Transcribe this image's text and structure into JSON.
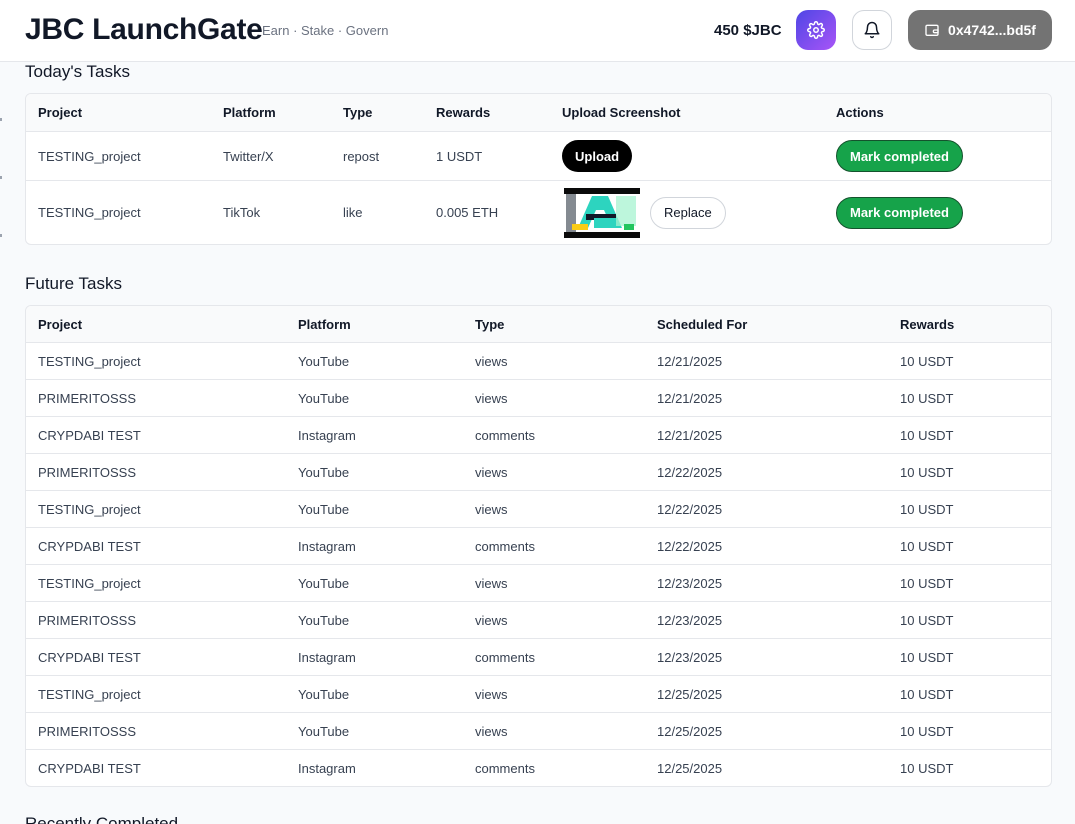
{
  "header": {
    "brand": "JBC LaunchGate",
    "tagline": "Earn · Stake · Govern",
    "balance": "450 $JBC",
    "wallet": "0x4742...bd5f",
    "icons": {
      "settings": "gear-icon",
      "notifications": "bell-icon",
      "wallet": "wallet-icon"
    },
    "accent_gradient": [
      "#4f46e5",
      "#a855f7"
    ]
  },
  "today": {
    "title": "Today's Tasks",
    "columns": [
      "Project",
      "Platform",
      "Type",
      "Rewards",
      "Upload Screenshot",
      "Actions"
    ],
    "rows": [
      {
        "project": "TESTING_project",
        "platform": "Twitter/X",
        "type": "repost",
        "rewards": "1 USDT",
        "upload_label": "Upload",
        "action": "Mark completed"
      },
      {
        "project": "TESTING_project",
        "platform": "TikTok",
        "type": "like",
        "rewards": "0.005 ETH",
        "replace_label": "Replace",
        "action": "Mark completed"
      }
    ]
  },
  "future": {
    "title": "Future Tasks",
    "columns": [
      "Project",
      "Platform",
      "Type",
      "Scheduled For",
      "Rewards"
    ],
    "rows": [
      {
        "project": "TESTING_project",
        "platform": "YouTube",
        "type": "views",
        "date": "12/21/2025",
        "rewards": "10 USDT"
      },
      {
        "project": "PRIMERITOSSS",
        "platform": "YouTube",
        "type": "views",
        "date": "12/21/2025",
        "rewards": "10 USDT"
      },
      {
        "project": "CRYPDABI TEST",
        "platform": "Instagram",
        "type": "comments",
        "date": "12/21/2025",
        "rewards": "10 USDT"
      },
      {
        "project": "PRIMERITOSSS",
        "platform": "YouTube",
        "type": "views",
        "date": "12/22/2025",
        "rewards": "10 USDT"
      },
      {
        "project": "TESTING_project",
        "platform": "YouTube",
        "type": "views",
        "date": "12/22/2025",
        "rewards": "10 USDT"
      },
      {
        "project": "CRYPDABI TEST",
        "platform": "Instagram",
        "type": "comments",
        "date": "12/22/2025",
        "rewards": "10 USDT"
      },
      {
        "project": "TESTING_project",
        "platform": "YouTube",
        "type": "views",
        "date": "12/23/2025",
        "rewards": "10 USDT"
      },
      {
        "project": "PRIMERITOSSS",
        "platform": "YouTube",
        "type": "views",
        "date": "12/23/2025",
        "rewards": "10 USDT"
      },
      {
        "project": "CRYPDABI TEST",
        "platform": "Instagram",
        "type": "comments",
        "date": "12/23/2025",
        "rewards": "10 USDT"
      },
      {
        "project": "TESTING_project",
        "platform": "YouTube",
        "type": "views",
        "date": "12/25/2025",
        "rewards": "10 USDT"
      },
      {
        "project": "PRIMERITOSSS",
        "platform": "YouTube",
        "type": "views",
        "date": "12/25/2025",
        "rewards": "10 USDT"
      },
      {
        "project": "CRYPDABI TEST",
        "platform": "Instagram",
        "type": "comments",
        "date": "12/25/2025",
        "rewards": "10 USDT"
      }
    ]
  },
  "recent": {
    "title": "Recently Completed"
  },
  "colors": {
    "success": "#16a34a",
    "wallet_bg": "#737373",
    "border": "#e5e7eb"
  }
}
